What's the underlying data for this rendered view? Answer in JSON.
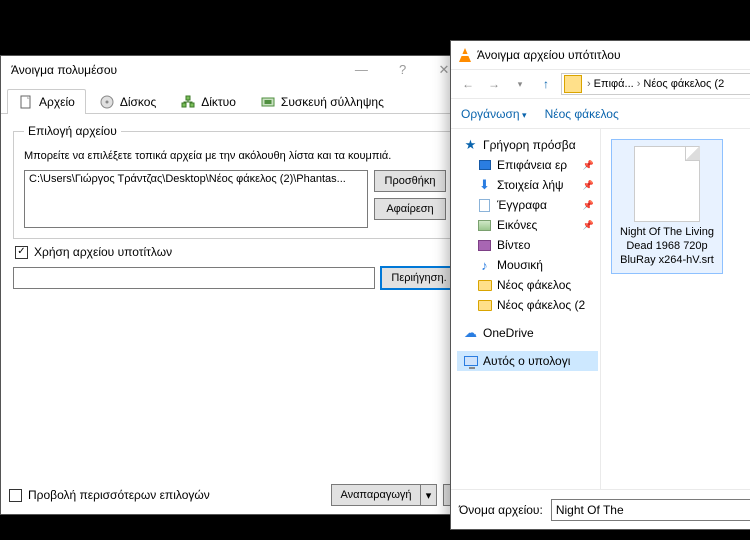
{
  "vlc": {
    "title": "Άνοιγμα πολυμέσου",
    "tabs": {
      "file": "Αρχείο",
      "disc": "Δίσκος",
      "net": "Δίκτυο",
      "capture": "Συσκευή σύλληψης"
    },
    "fileSelection": {
      "legend": "Επιλογή αρχείου",
      "hint": "Μπορείτε να επιλέξετε τοπικά αρχεία με την ακόλουθη λίστα και τα κουμπιά.",
      "path": "C:\\Users\\Γιώργος Τράντζας\\Desktop\\Νέος φάκελος (2)\\Phantas...",
      "add": "Προσθήκη",
      "remove": "Αφαίρεση"
    },
    "subs": {
      "checkbox": "Χρήση αρχείου υποτίτλων",
      "browse": "Περιήγηση."
    },
    "more": "Προβολή περισσότερων επιλογών",
    "play": "Αναπαραγωγή"
  },
  "dlg": {
    "title": "Άνοιγμα αρχείου υπότιτλου",
    "breadcrumb": {
      "a": "Επιφά...",
      "b": "Νέος φάκελος (2"
    },
    "cmd": {
      "organize": "Οργάνωση",
      "newfolder": "Νέος φάκελος"
    },
    "tree": {
      "quick": "Γρήγορη πρόσβα",
      "desktop": "Επιφάνεια ερ",
      "downloads": "Στοιχεία λήψ",
      "documents": "Έγγραφα",
      "pictures": "Εικόνες",
      "videos": "Βίντεο",
      "music": "Μουσική",
      "folder1": "Νέος φάκελος",
      "folder2": "Νέος φάκελος (2",
      "onedrive": "OneDrive",
      "thispc": "Αυτός ο υπολογι"
    },
    "file_label": "Night Of The Living Dead 1968 720p BluRay x264-hV.srt",
    "filename_label": "Όνομα αρχείου:",
    "filename_value": "Night Of The"
  }
}
